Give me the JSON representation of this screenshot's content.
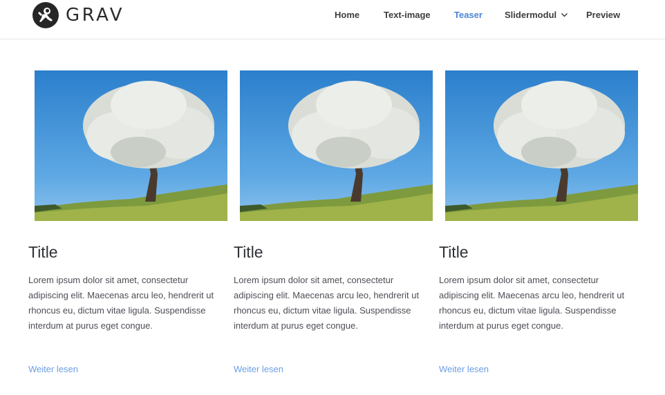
{
  "header": {
    "brand": {
      "name": "GRAV",
      "logo_icon": "astronaut-logo-icon"
    },
    "nav": [
      {
        "label": "Home",
        "active": false
      },
      {
        "label": "Text-image",
        "active": false
      },
      {
        "label": "Teaser",
        "active": true
      },
      {
        "label": "Slidermodul",
        "active": false,
        "dropdown_icon": "chevron-down-icon"
      },
      {
        "label": "Preview",
        "active": false
      }
    ]
  },
  "teasers": [
    {
      "image": "blossoming-tree-image",
      "title": "Title",
      "text": "Lorem ipsum dolor sit amet, consectetur adipiscing elit. Maecenas arcu leo, hendrerit ut rhoncus eu, dictum vitae ligula. Suspendisse interdum at purus eget congue.",
      "link_label": "Weiter lesen"
    },
    {
      "image": "blossoming-tree-image",
      "title": "Title",
      "text": "Lorem ipsum dolor sit amet, consectetur adipiscing elit. Maecenas arcu leo, hendrerit ut rhoncus eu, dictum vitae ligula. Suspendisse interdum at purus eget congue.",
      "link_label": "Weiter lesen"
    },
    {
      "image": "blossoming-tree-image",
      "title": "Title",
      "text": "Lorem ipsum dolor sit amet, consectetur adipiscing elit. Maecenas arcu leo, hendrerit ut rhoncus eu, dictum vitae ligula. Suspendisse interdum at purus eget congue.",
      "link_label": "Weiter lesen"
    }
  ],
  "colors": {
    "accent": "#4a85d6",
    "link": "#6c9ee3",
    "nav_text": "#3d3d3d",
    "title": "#2f3237",
    "body_text": "#4b4e55"
  }
}
